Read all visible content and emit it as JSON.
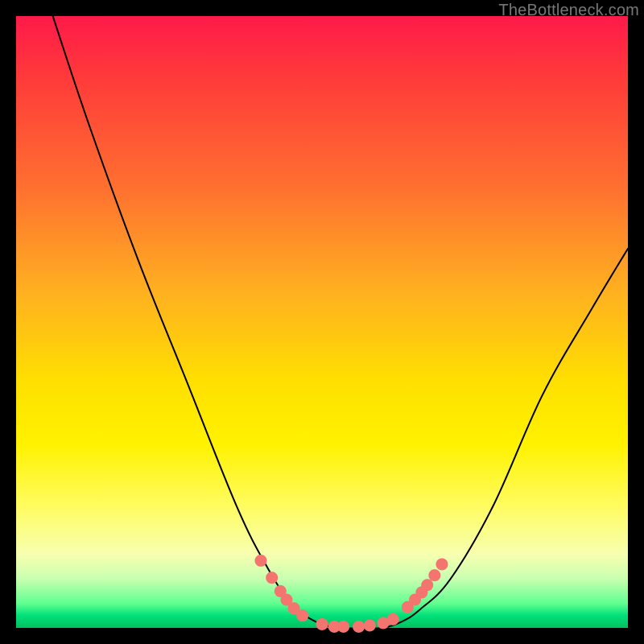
{
  "watermark": "TheBottleneck.com",
  "chart_data": {
    "type": "line",
    "title": "",
    "xlabel": "",
    "ylabel": "",
    "xlim": [
      0,
      100
    ],
    "ylim": [
      0,
      100
    ],
    "grid": false,
    "legend": false,
    "series": [
      {
        "name": "curve",
        "x": [
          6,
          12,
          20,
          28,
          36,
          41,
          45,
          49,
          53,
          57,
          60,
          63,
          66,
          71,
          78,
          86,
          94,
          100
        ],
        "y": [
          100,
          82,
          60,
          40,
          20,
          10,
          4,
          1,
          0,
          0,
          0,
          1,
          3,
          8,
          20,
          38,
          52,
          62
        ]
      }
    ],
    "markers": {
      "name": "highlight-dots",
      "x": [
        40.0,
        41.8,
        43.2,
        44.2,
        45.4,
        46.8,
        50.0,
        52.0,
        53.5,
        56.0,
        57.8,
        60.0,
        61.6,
        64.0,
        65.2,
        66.3,
        67.2,
        68.4,
        69.6
      ],
      "y": [
        11.0,
        8.2,
        6.0,
        4.6,
        3.2,
        2.0,
        0.6,
        0.2,
        0.2,
        0.2,
        0.4,
        0.8,
        1.4,
        3.4,
        4.6,
        5.8,
        7.0,
        8.6,
        10.4
      ]
    },
    "colors": {
      "gradient_top": "#ff1a4a",
      "gradient_mid": "#ffe000",
      "gradient_bottom": "#00c060",
      "curve": "#000000",
      "dots": "#f4756f",
      "frame": "#000000"
    }
  }
}
